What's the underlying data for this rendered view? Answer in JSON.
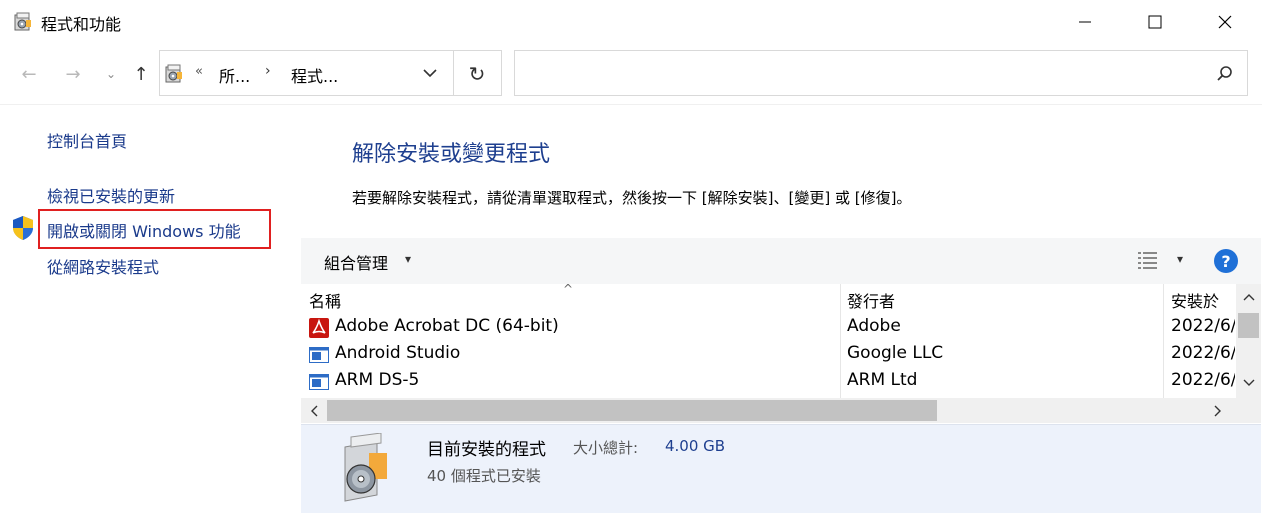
{
  "window": {
    "title": "程式和功能",
    "minimize_label": "—",
    "maximize_label": "☐",
    "close_label": "✕"
  },
  "nav": {
    "back_label": "←",
    "forward_label": "→",
    "recent_label": "⌄",
    "up_label": "↑",
    "refresh_label": "↻"
  },
  "address": {
    "overflow": "«",
    "segments": [
      "所...",
      "程式..."
    ],
    "separator": "›"
  },
  "search": {
    "value": "",
    "placeholder": ""
  },
  "sidebar": {
    "items": [
      {
        "label": "控制台首頁"
      },
      {
        "label": "檢視已安裝的更新"
      },
      {
        "label": "開啟或關閉 Windows 功能",
        "icon": "shield-icon"
      },
      {
        "label": "從網路安裝程式"
      }
    ]
  },
  "main": {
    "title": "解除安裝或變更程式",
    "description": "若要解除安裝程式，請從清單選取程式，然後按一下 [解除安裝]、[變更] 或 [修復]。"
  },
  "toolbar": {
    "organize_label": "組合管理",
    "caret": "▾",
    "help_label": "?"
  },
  "table": {
    "columns": [
      "名稱",
      "發行者",
      "安裝於"
    ],
    "sort_indicator": "^",
    "rows": [
      {
        "name": "Adobe Acrobat DC (64-bit)",
        "publisher": "Adobe",
        "installed": "2022/6/",
        "icon": "acrobat-icon"
      },
      {
        "name": "Android Studio",
        "publisher": "Google LLC",
        "installed": "2022/6/",
        "icon": "program-window-icon"
      },
      {
        "name": "ARM DS-5",
        "publisher": "ARM Ltd",
        "installed": "2022/6/",
        "icon": "program-window-icon"
      }
    ],
    "scroll_up": "⌃",
    "scroll_down": "⌄",
    "scroll_left": "‹",
    "scroll_right": "›"
  },
  "details": {
    "title": "目前安裝的程式",
    "size_label": "大小總計:",
    "size_value": "4.00 GB",
    "count_text": "40 個程式已安裝"
  },
  "colors": {
    "link": "#1a3a8b",
    "heading": "#1e3f8f",
    "highlight_border": "#e02020",
    "help": "#1f70d7",
    "details_bg": "#edf2fb"
  }
}
